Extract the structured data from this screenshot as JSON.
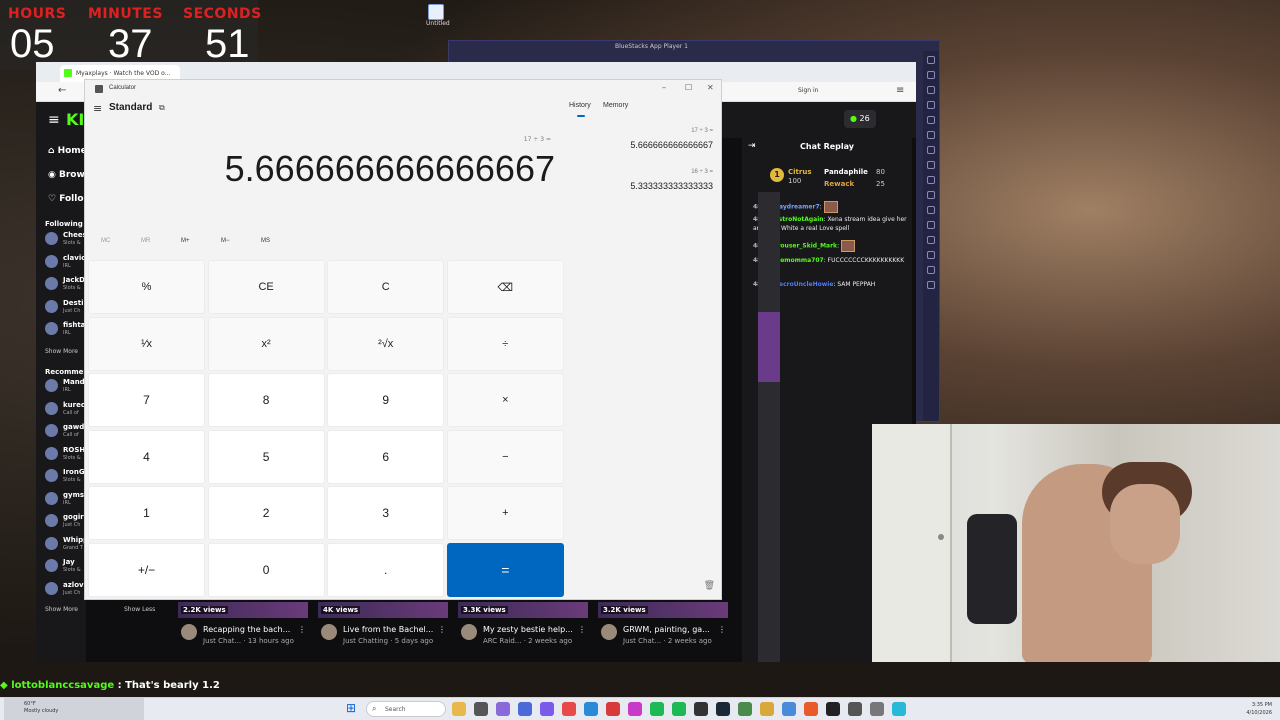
{
  "timer": {
    "hours_label": "HOURS",
    "minutes_label": "MINUTES",
    "seconds_label": "SECONDS",
    "hours": "05",
    "minutes": "37",
    "seconds": "51"
  },
  "desktop_icon": {
    "label": "Untitled"
  },
  "bluestacks": {
    "title": "BlueStacks App Player 1"
  },
  "browser": {
    "tab_title": "Myaxplays · Watch the VOD o...",
    "sign_in": "Sign in",
    "points": "26",
    "nav": {
      "home": "Home",
      "browse": "Brow",
      "following": "Follo"
    },
    "following_header": "Following",
    "following": [
      {
        "name": "Chees",
        "cat": "Slots &"
      },
      {
        "name": "clavic",
        "cat": "IRL"
      },
      {
        "name": "JackD",
        "cat": "Slots &"
      },
      {
        "name": "Destin",
        "cat": "Just Ch"
      },
      {
        "name": "fishtar",
        "cat": "IRL"
      }
    ],
    "show_more": "Show More",
    "recommended_header": "Recommen",
    "recommended": [
      {
        "name": "Mande",
        "cat": "IRL"
      },
      {
        "name": "kurec",
        "cat": "Call of"
      },
      {
        "name": "gawde",
        "cat": "Call of"
      },
      {
        "name": "ROSH",
        "cat": "Slots &"
      },
      {
        "name": "IronG",
        "cat": "Slots &"
      },
      {
        "name": "gymst",
        "cat": "IRL"
      },
      {
        "name": "gogirl",
        "cat": "Just Ch"
      },
      {
        "name": "Whipp",
        "cat": "Grand T"
      },
      {
        "name": "Jay",
        "cat": "Slots &"
      },
      {
        "name": "azlove",
        "cat": "Just Ch"
      }
    ],
    "show_more_2": "Show More",
    "show_less": "Show Less",
    "videos": [
      {
        "views": "2.2K views",
        "title": "Recapping the bach...",
        "sub": "Just Chat... · 13 hours ago"
      },
      {
        "views": "4K views",
        "title": "Live from the Bachel...",
        "sub": "Just Chatting · 5 days ago"
      },
      {
        "views": "3.3K views",
        "title": "My zesty bestie help...",
        "sub": "ARC Raid... · 2 weeks ago"
      },
      {
        "views": "3.2K views",
        "title": "GRWM, painting, ga...",
        "sub": "Just Chat... · 2 weeks ago"
      }
    ]
  },
  "chat": {
    "header": "Chat Replay",
    "gifters": [
      {
        "name": "Citrus",
        "count": "100"
      },
      {
        "name": "Pandaphile",
        "count": "80"
      },
      {
        "name": "Rewack",
        "count": "25"
      }
    ],
    "rank": "1",
    "messages": [
      {
        "time": "48:48",
        "user": "Daydreamer7",
        "text": ":",
        "color": "#7aa0ff"
      },
      {
        "time": "48:51",
        "user": "AstroNotAgain",
        "text": ": Xena stream idea give her and Nick White a real Love spell",
        "color": "#53fc18"
      },
      {
        "time": "48:51",
        "user": "Trouser_Skid_Mark",
        "text": ":",
        "color": "#53fc18"
      },
      {
        "time": "48:51",
        "user": "joemomma707",
        "text": ": FUCCCCCCCKKKKKKKKKK",
        "color": "#53fc18"
      },
      {
        "time": "48:52",
        "user": "NecroUncleHowie",
        "text": ": SAM PEPPAH",
        "color": "#4d7cff"
      }
    ]
  },
  "calculator": {
    "title": "Calculator",
    "mode": "Standard",
    "tabs": {
      "history": "History",
      "memory": "Memory"
    },
    "expression": "17 ÷ 3 =",
    "display": "5.666666666666667",
    "memory_buttons": [
      "MC",
      "MR",
      "M+",
      "M−",
      "MS"
    ],
    "history": [
      {
        "expr": "17  ÷  3 =",
        "result": "5.666666666666667"
      },
      {
        "expr": "16  ÷  3 =",
        "result": "5.333333333333333"
      }
    ],
    "keys": [
      "%",
      "CE",
      "C",
      "⌫",
      "¹⁄x",
      "x²",
      "²√x",
      "÷",
      "7",
      "8",
      "9",
      "×",
      "4",
      "5",
      "6",
      "−",
      "1",
      "2",
      "3",
      "+",
      "+/−",
      "0",
      ".",
      "="
    ]
  },
  "overlay": {
    "user": "lottoblanccsavage",
    "text": " : That's bearly 1.2"
  },
  "taskbar": {
    "weather_temp": "60°F",
    "weather_desc": "Mostly cloudy",
    "search": "Search",
    "time": "3:35 PM",
    "date": "4/10/2026"
  },
  "colors": {
    "kick_green": "#53fc18",
    "calc_accent": "#0067c0",
    "timer_red": "#e02020"
  }
}
